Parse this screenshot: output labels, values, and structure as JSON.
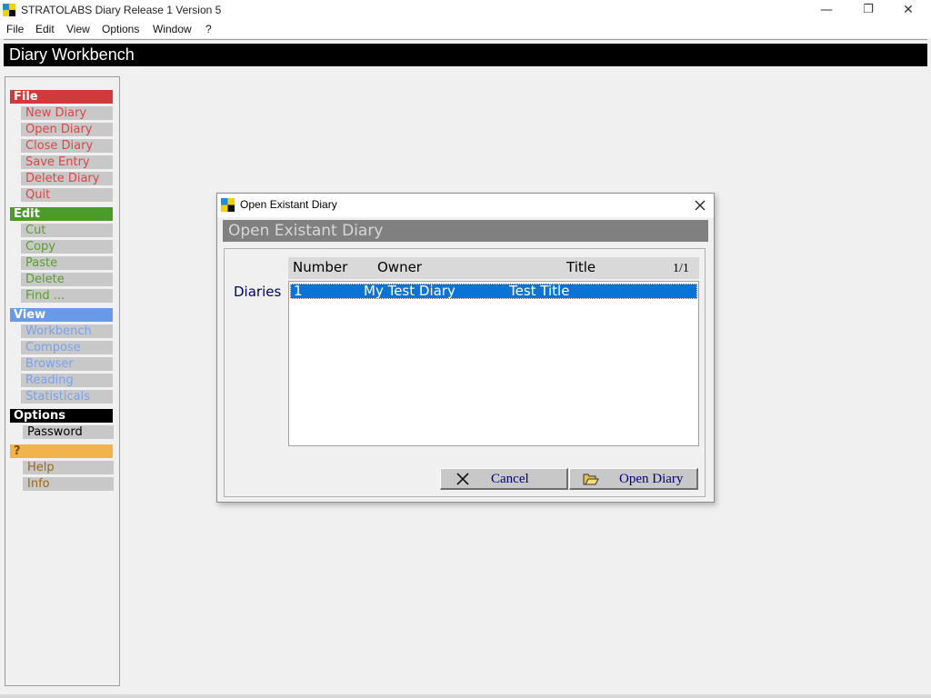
{
  "window": {
    "title": "STRATOLABS Diary Release 1 Version 5",
    "controls": {
      "minimize": "—",
      "restore": "❐",
      "close": "✕"
    }
  },
  "menubar": [
    "File",
    "Edit",
    "View",
    "Options",
    "Window",
    "?"
  ],
  "header": {
    "title": "Diary Workbench"
  },
  "sidebar": {
    "sections": [
      {
        "label": "File",
        "color": "#d03a3a",
        "text_color": "#d94848",
        "items": [
          "New Diary",
          "Open Diary",
          "Close Diary",
          "Save Entry",
          "Delete Diary",
          "Quit"
        ]
      },
      {
        "label": "Edit",
        "color": "#4c9a2a",
        "text_color": "#5a9e2c",
        "items": [
          "Cut",
          "Copy",
          "Paste",
          "Delete",
          "Find ..."
        ]
      },
      {
        "label": "View",
        "color": "#6a99e8",
        "text_color": "#7aa2ec",
        "items": [
          "Workbench",
          "Compose",
          "Browser",
          "Reading",
          "Statisticals"
        ]
      },
      {
        "label": "Options",
        "color": "#000000",
        "text_color": "#000000",
        "items": [
          "Password"
        ]
      },
      {
        "label": "?",
        "color": "#f2b44a",
        "text_color": "#9a6a16",
        "items": [
          "Help",
          "Info"
        ]
      }
    ]
  },
  "dialog": {
    "title": "Open Existant Diary",
    "banner": "Open Existant Diary",
    "list_label": "Diaries",
    "columns": [
      "Number",
      "Owner",
      "Title"
    ],
    "page_indicator": "1/1",
    "rows": [
      {
        "number": "1",
        "owner": "My Test Diary",
        "title": "Test Title",
        "selected": true
      }
    ],
    "buttons": {
      "cancel": "Cancel",
      "open": "Open Diary"
    }
  }
}
